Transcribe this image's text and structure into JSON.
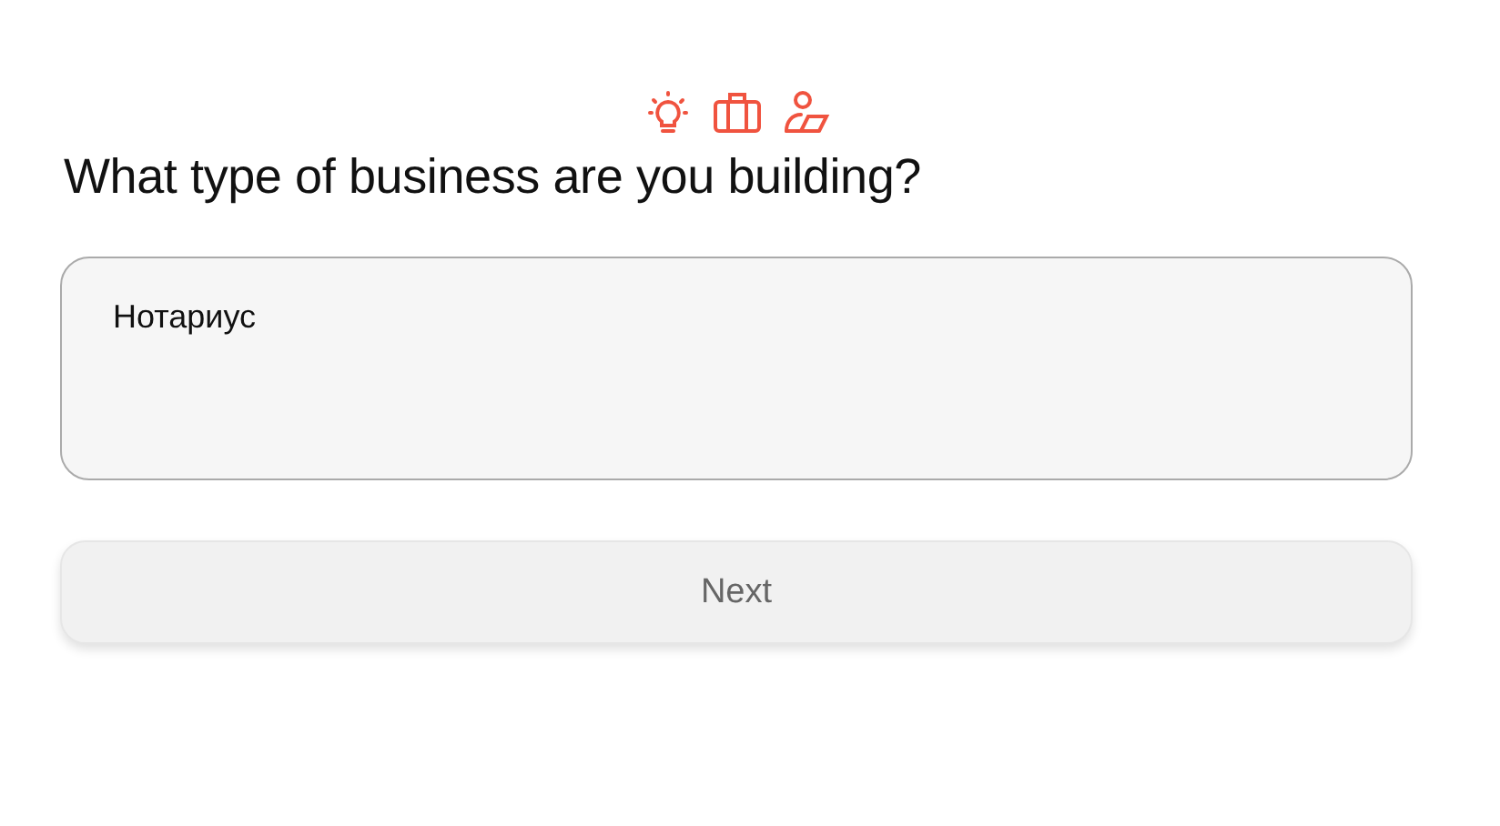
{
  "steps": [
    {
      "kind": "idea"
    },
    {
      "kind": "business"
    },
    {
      "kind": "person"
    }
  ],
  "question": "What type of business are you building?",
  "answer": {
    "value": "Нотариус"
  },
  "button": {
    "label": "Next"
  }
}
